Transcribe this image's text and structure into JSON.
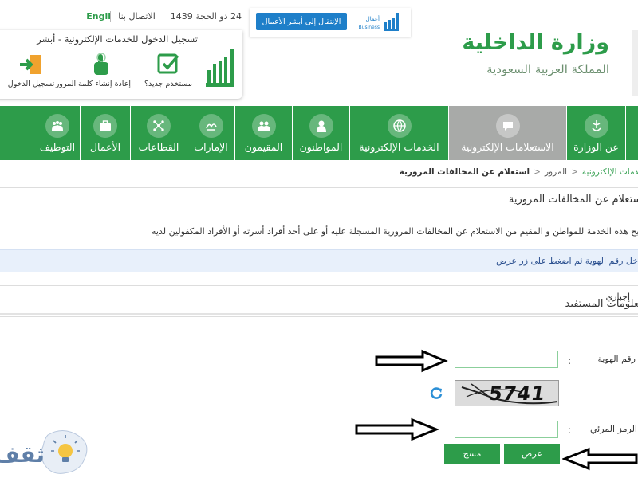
{
  "topbar": {
    "date": "24 ذو الحجة 1439",
    "contact": "الاتصال بنا",
    "language": "English"
  },
  "login": {
    "title": "تسجيل الدخول للخدمات الإلكترونية - أبشر",
    "items": [
      {
        "label": "مستخدم جديد؟",
        "icon": "new-user-icon"
      },
      {
        "label": "إعادة إنشاء كلمة المرور",
        "icon": "reset-password-icon"
      },
      {
        "label": "تسجيل الدخول",
        "icon": "login-icon"
      }
    ]
  },
  "business": {
    "button": "الإنتقال إلى أبشر الأعمال",
    "logo_text_ar": "أعمال",
    "logo_text_en": "Business"
  },
  "ministry": {
    "name": "وزارة الداخلية",
    "country": "المملكة العربية السعودية"
  },
  "nav": {
    "items": [
      {
        "label": "عن الوزارة",
        "icon": "emblem-icon",
        "active": false
      },
      {
        "label": "الاستعلامات الإلكترونية",
        "icon": "chat-icon",
        "active": true
      },
      {
        "label": "الخدمات الإلكترونية",
        "icon": "globe-icon",
        "active": false
      },
      {
        "label": "المواطنون",
        "icon": "citizen-icon",
        "active": false
      },
      {
        "label": "المقيمون",
        "icon": "residents-icon",
        "active": false
      },
      {
        "label": "الإمارات",
        "icon": "emirates-icon",
        "active": false
      },
      {
        "label": "القطاعات",
        "icon": "sectors-icon",
        "active": false
      },
      {
        "label": "الأعمال",
        "icon": "briefcase-icon",
        "active": false
      },
      {
        "label": "التوظيف",
        "icon": "employment-icon",
        "active": false
      }
    ]
  },
  "breadcrumb": {
    "items": [
      "الخدمات الإلكترونية",
      "المرور"
    ],
    "current": "استعلام عن المخالفات المرورية"
  },
  "page": {
    "title": "استعلام عن المخالفات المرورية",
    "description": "تتيح هذه الخدمة للمواطن و المقيم من الاستعلام عن المخالفات المرورية المسجلة عليه أو على أحد أفراد أسرته أو الأفراد المكفولين لديه",
    "info": "أدخل رقم الهوية ثم اضغط على زر عرض",
    "mandatory": "إجباري",
    "section_title": "معلومات المستفيد"
  },
  "form": {
    "id_label": "رقم الهوية",
    "id_value": "",
    "captcha_label": "الرمز المرئي",
    "captcha_value": "",
    "captcha_image_text": "5741",
    "required_mark": "*",
    "colon": ":",
    "submit": "عرض",
    "clear": "مسح"
  },
  "watermark": {
    "text": "ثقف"
  },
  "colors": {
    "green": "#2d9c4a",
    "active_tab": "#a8aaa8",
    "info_bg": "#e8f0fb",
    "blue": "#1e7fc9"
  }
}
